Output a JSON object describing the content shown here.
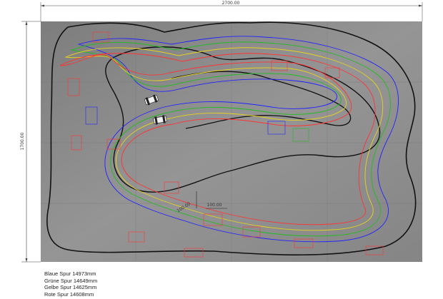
{
  "dimensions": {
    "width": "2700.00",
    "height": "1700.00"
  },
  "annotations": {
    "offset_a": "100.00",
    "offset_b": "100.00"
  },
  "legend": [
    {
      "text": "Blaue Spur 14973mm",
      "color": "#2222ff"
    },
    {
      "text": "Grüne Spur 14649mm",
      "color": "#22bb22"
    },
    {
      "text": "Gelbe Spur 14625mm",
      "color": "#e6d21e"
    },
    {
      "text": "Rote Spur  14608mm",
      "color": "#ff3333"
    }
  ],
  "colors": {
    "floor": "#8b8b8b",
    "track_edge": "#111111",
    "blue": "#2222ff",
    "green": "#22bb22",
    "yellow": "#e6d21e",
    "red": "#ff3333"
  }
}
